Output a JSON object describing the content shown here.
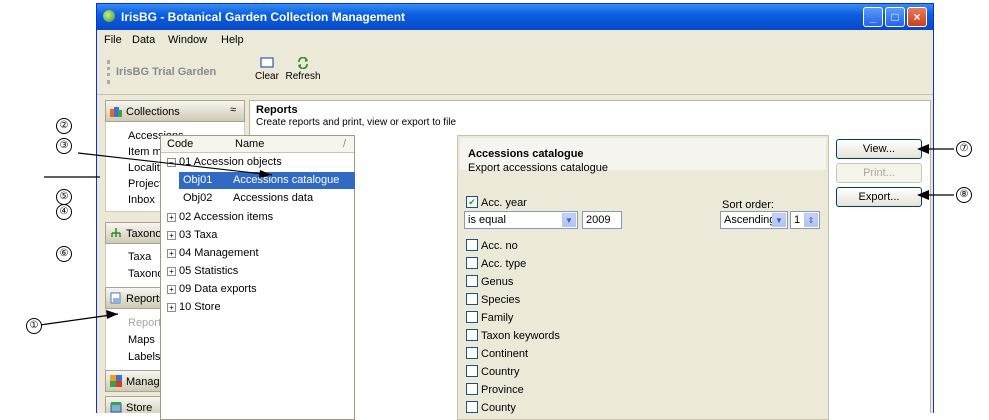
{
  "window": {
    "title": "IrisBG - Botanical Garden Collection Management",
    "menu": [
      "File",
      "Data",
      "Window",
      "Help"
    ],
    "minimize": "_",
    "maximize": "□",
    "close": "×"
  },
  "toolbar": {
    "garden_label": "IrisBG Trial Garden",
    "clear_label": "Clear",
    "refresh_label": "Refresh"
  },
  "sidebar": {
    "collections": {
      "label": "Collections",
      "chevron": "≈",
      "items": [
        "Accessions",
        "Item management",
        "Localities",
        "Projects",
        "Inbox"
      ]
    },
    "taxonomy": {
      "label": "Taxonomy",
      "chevron": "≈",
      "items": [
        "Taxa",
        "Taxonomic groups"
      ]
    },
    "reports": {
      "label": "Reports",
      "chevron": "≈",
      "items": [
        "Reports",
        "Maps",
        "Labels"
      ]
    },
    "management": {
      "label": "Management",
      "chevron": "≈"
    },
    "store": {
      "label": "Store",
      "chevron": "≈"
    }
  },
  "content": {
    "heading": "Reports",
    "subheading": "Create reports and print, view or export to file"
  },
  "tree": {
    "col_code": "Code",
    "col_name": "Name",
    "col_sort": "/",
    "expanded": "01 Accession objects",
    "rows": [
      {
        "code": "Obj01",
        "name": "Accessions catalogue"
      },
      {
        "code": "Obj02",
        "name": "Accessions data"
      }
    ],
    "nodes": [
      "02 Accession items",
      "03 Taxa",
      "04 Management",
      "05 Statistics",
      "09 Data exports",
      "10 Store"
    ]
  },
  "report": {
    "title": "Accessions catalogue",
    "description": "Export accessions catalogue",
    "acc_year_label": "Acc. year",
    "condition": "is equal",
    "year_value": "2009",
    "sort_label": "Sort order:",
    "sort_value": "Ascending",
    "sort_num": "1",
    "fields": [
      "Acc. no",
      "Acc. type",
      "Genus",
      "Species",
      "Family",
      "Taxon keywords",
      "Continent",
      "Country",
      "Province",
      "County"
    ]
  },
  "buttons": {
    "view": "View...",
    "print": "Print...",
    "export": "Export..."
  },
  "callouts": [
    "②",
    "③",
    "⑤",
    "④",
    "⑥",
    "①",
    "⑦",
    "⑧"
  ],
  "colors": {
    "titlebar": "#0a5fe0",
    "selection": "#316ac5",
    "panel": "#ece9d8"
  }
}
